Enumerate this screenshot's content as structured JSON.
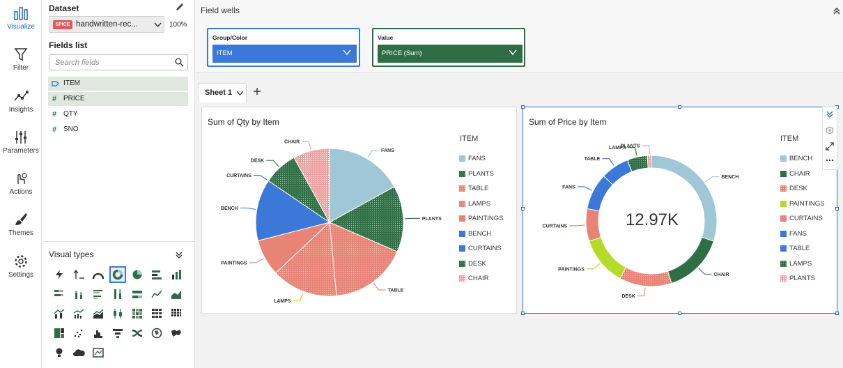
{
  "nav": {
    "items": [
      {
        "label": "Visualize",
        "icon": "visualize-icon"
      },
      {
        "label": "Filter",
        "icon": "filter-icon"
      },
      {
        "label": "Insights",
        "icon": "insights-icon"
      },
      {
        "label": "Parameters",
        "icon": "parameters-icon"
      },
      {
        "label": "Actions",
        "icon": "actions-icon"
      },
      {
        "label": "Themes",
        "icon": "themes-icon"
      },
      {
        "label": "Settings",
        "icon": "gear-icon"
      }
    ]
  },
  "dataset": {
    "heading": "Dataset",
    "badge": "SPICE",
    "name": "handwritten-rec...",
    "percent": "100%"
  },
  "fields": {
    "heading": "Fields list",
    "search_placeholder": "Search fields",
    "items": [
      {
        "name": "ITEM",
        "type": "dimension"
      },
      {
        "name": "PRICE",
        "type": "measure"
      },
      {
        "name": "QTY",
        "type": "measure"
      },
      {
        "name": "SNO",
        "type": "measure"
      }
    ]
  },
  "visual_types": {
    "heading": "Visual types"
  },
  "wells": {
    "heading": "Field wells",
    "group_label": "Group/Color",
    "group_value": "ITEM",
    "value_label": "Value",
    "value_value": "PRICE (Sum)"
  },
  "sheet": {
    "tab": "Sheet 1"
  },
  "colors": {
    "accent": "#1b69c9",
    "sky": "#9fc7d6",
    "green": "#2f6e44",
    "salmon": "#e88476",
    "lime": "#b5db28",
    "blue": "#3c78d8",
    "pink": "#f0a0a0"
  },
  "chart_data": [
    {
      "type": "pie",
      "title": "Sum of Qty by Item",
      "legend_title": "ITEM",
      "legend": [
        "FANS",
        "PLANTS",
        "TABLE",
        "LAMPS",
        "PAINTINGS",
        "BENCH",
        "CURTAINS",
        "DESK",
        "CHAIR"
      ],
      "slices": [
        {
          "label": "FANS",
          "value": 17.0
        },
        {
          "label": "PLANTS",
          "value": 14.5
        },
        {
          "label": "TABLE",
          "value": 17.0
        },
        {
          "label": "LAMPS",
          "value": 14.5
        },
        {
          "label": "PAINTINGS",
          "value": 8.0
        },
        {
          "label": "BENCH",
          "value": 13.5
        },
        {
          "label": "CURTAINS",
          "value": 0.0
        },
        {
          "label": "DESK",
          "value": 7.5
        },
        {
          "label": "CHAIR",
          "value": 8.0
        }
      ]
    },
    {
      "type": "pie",
      "subtype": "donut",
      "title": "Sum of Price by Item",
      "center_label": "12.97K",
      "legend_title": "ITEM",
      "legend": [
        "BENCH",
        "CHAIR",
        "DESK",
        "PAINTINGS",
        "CURTAINS",
        "FANS",
        "TABLE",
        "LAMPS",
        "PLANTS"
      ],
      "slices": [
        {
          "label": "BENCH",
          "value": 30.0
        },
        {
          "label": "CHAIR",
          "value": 15.0
        },
        {
          "label": "DESK",
          "value": 13.0
        },
        {
          "label": "PAINTINGS",
          "value": 12.0
        },
        {
          "label": "CURTAINS",
          "value": 8.0
        },
        {
          "label": "FANS",
          "value": 9.0
        },
        {
          "label": "TABLE",
          "value": 7.0
        },
        {
          "label": "LAMPS",
          "value": 5.0
        },
        {
          "label": "PLANTS",
          "value": 1.0
        }
      ]
    }
  ]
}
